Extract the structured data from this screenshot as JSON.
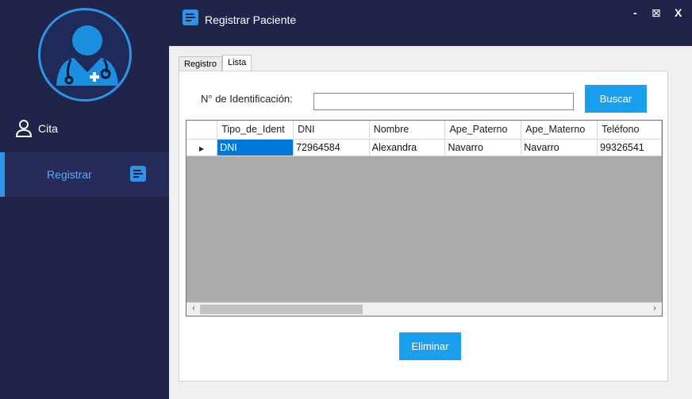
{
  "app": {
    "title": "Registrar Paciente",
    "window_controls": {
      "minimize": "-",
      "maximize": "⊠",
      "close": "X"
    }
  },
  "sidebar": {
    "items": [
      {
        "label": "Cita",
        "icon": "user-icon"
      },
      {
        "label": "Registrar",
        "icon": "form-icon",
        "active": true
      }
    ]
  },
  "tabs": [
    {
      "label": "Registro",
      "active": false
    },
    {
      "label": "Lista",
      "active": true
    }
  ],
  "search": {
    "label": "N° de Identificación:",
    "value": "",
    "button": "Buscar"
  },
  "grid": {
    "columns": [
      "Tipo_de_Ident",
      "DNI",
      "Nombre",
      "Ape_Paterno",
      "Ape_Materno",
      "Teléfono"
    ],
    "rows": [
      [
        "DNI",
        "72964584",
        "Alexandra",
        "Navarro",
        "Navarro",
        "99326541"
      ]
    ]
  },
  "actions": {
    "delete": "Eliminar"
  },
  "colors": {
    "sidebar": "#20244a",
    "accent": "#1aa0ee",
    "selection": "#0078d7",
    "grid_empty": "#ababab"
  }
}
